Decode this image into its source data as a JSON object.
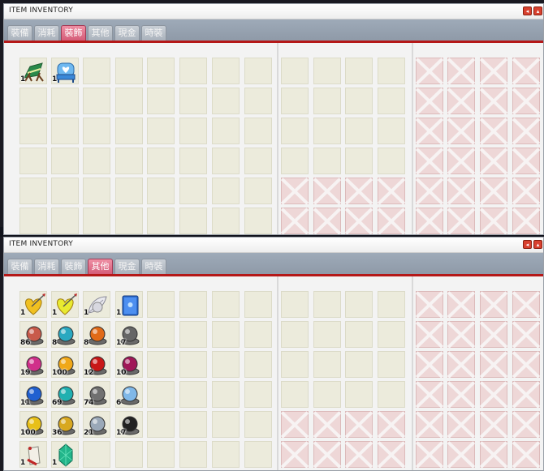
{
  "windows": [
    {
      "title": "ITEM INVENTORY",
      "tabs": [
        "裝備",
        "消耗",
        "裝飾",
        "其他",
        "現金",
        "時裝"
      ],
      "active_tab": 2,
      "items": [
        {
          "row": 0,
          "col": 0,
          "icon": "beach-chair-icon",
          "qty": "1"
        },
        {
          "row": 0,
          "col": 1,
          "icon": "heart-bench-icon",
          "qty": "1"
        }
      ],
      "locked_cells": [
        [
          4,
          8
        ],
        [
          4,
          9
        ],
        [
          4,
          10
        ],
        [
          4,
          11
        ],
        [
          5,
          8
        ],
        [
          5,
          9
        ],
        [
          5,
          10
        ],
        [
          5,
          11
        ]
      ]
    },
    {
      "title": "ITEM INVENTORY",
      "tabs": [
        "裝備",
        "消耗",
        "裝飾",
        "其他",
        "現金",
        "時裝"
      ],
      "active_tab": 3,
      "items": [
        {
          "row": 0,
          "col": 0,
          "icon": "heart-arrow-icon",
          "qty": "1",
          "color": "#f0c020"
        },
        {
          "row": 0,
          "col": 1,
          "icon": "heart-arrow-icon",
          "qty": "1",
          "color": "#e8ea30"
        },
        {
          "row": 0,
          "col": 2,
          "icon": "white-feather-icon",
          "qty": "1"
        },
        {
          "row": 0,
          "col": 3,
          "icon": "blue-book-icon",
          "qty": "1"
        },
        {
          "row": 1,
          "col": 0,
          "icon": "ore-icon",
          "qty": "86",
          "color": "#c85a4a"
        },
        {
          "row": 1,
          "col": 1,
          "icon": "ore-icon",
          "qty": "8",
          "color": "#2aa8c0"
        },
        {
          "row": 1,
          "col": 2,
          "icon": "ore-icon",
          "qty": "8",
          "color": "#e06a18"
        },
        {
          "row": 1,
          "col": 3,
          "icon": "ore-icon",
          "qty": "17",
          "color": "#666666"
        },
        {
          "row": 2,
          "col": 0,
          "icon": "ore-icon",
          "qty": "19",
          "color": "#d0308a"
        },
        {
          "row": 2,
          "col": 1,
          "icon": "ore-icon",
          "qty": "100",
          "color": "#f0a818"
        },
        {
          "row": 2,
          "col": 2,
          "icon": "ore-icon",
          "qty": "12",
          "color": "#c81818"
        },
        {
          "row": 2,
          "col": 3,
          "icon": "ore-icon",
          "qty": "10",
          "color": "#a01858"
        },
        {
          "row": 3,
          "col": 0,
          "icon": "ore-icon",
          "qty": "11",
          "color": "#2060d0"
        },
        {
          "row": 3,
          "col": 1,
          "icon": "ore-icon",
          "qty": "69",
          "color": "#20b0b0"
        },
        {
          "row": 3,
          "col": 2,
          "icon": "ore-icon",
          "qty": "74",
          "color": "#707070"
        },
        {
          "row": 3,
          "col": 3,
          "icon": "ore-icon",
          "qty": "6",
          "color": "#80b8e8"
        },
        {
          "row": 4,
          "col": 0,
          "icon": "ore-icon",
          "qty": "100",
          "color": "#e8c018"
        },
        {
          "row": 4,
          "col": 1,
          "icon": "ore-icon",
          "qty": "36",
          "color": "#d8a820"
        },
        {
          "row": 4,
          "col": 2,
          "icon": "ore-icon",
          "qty": "21",
          "color": "#9aa8b8"
        },
        {
          "row": 4,
          "col": 3,
          "icon": "ore-icon",
          "qty": "17",
          "color": "#222222"
        },
        {
          "row": 5,
          "col": 0,
          "icon": "scroll-icon",
          "qty": "1"
        },
        {
          "row": 5,
          "col": 1,
          "icon": "emerald-crystal-icon",
          "qty": "1"
        }
      ],
      "locked_cells": [
        [
          4,
          8
        ],
        [
          4,
          9
        ],
        [
          4,
          10
        ],
        [
          4,
          11
        ],
        [
          5,
          8
        ],
        [
          5,
          9
        ],
        [
          5,
          10
        ],
        [
          5,
          11
        ]
      ]
    }
  ]
}
